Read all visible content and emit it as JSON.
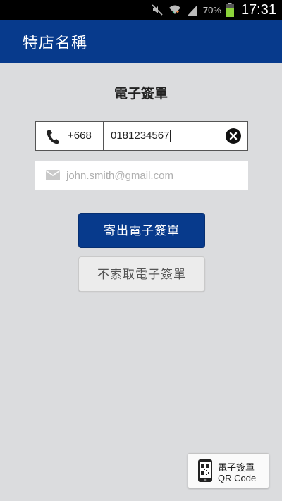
{
  "status_bar": {
    "battery_percent": "70%",
    "time": "17:31",
    "icons": [
      "mute-icon",
      "wifi-icon",
      "signal-icon",
      "battery-icon"
    ]
  },
  "app_bar": {
    "title": "特店名稱"
  },
  "main": {
    "heading": "電子簽單",
    "phone": {
      "country_code": "+668",
      "number": "0181234567",
      "icon": "phone-icon",
      "clear_icon": "clear-icon"
    },
    "email": {
      "value": "",
      "placeholder": "john.smith@gmail.com",
      "icon": "mail-icon"
    },
    "send_button": "寄出電子簽單",
    "decline_button": "不索取電子簽單"
  },
  "qr_button": {
    "line1": "電子簽單",
    "line2": "QR Code",
    "icon": "qr-code-icon"
  },
  "colors": {
    "accent": "#073a8c",
    "background": "#dbdcde"
  }
}
